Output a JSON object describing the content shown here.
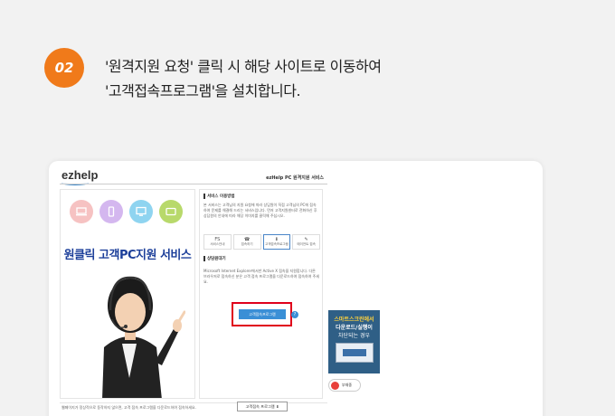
{
  "step": {
    "number": "02"
  },
  "instruction": {
    "line1": "'원격지원 요청' 클릭 시 해당 사이트로 이동하여",
    "line2": "'고객접속프로그램'을 설치합니다."
  },
  "site": {
    "logo": "ezhelp",
    "header_title": "ezHelp PC 원격지원 서비스",
    "service_title": "원클릭 고객PC지원 서비스",
    "icons": [
      "laptop-icon",
      "mobile-icon",
      "monitor-icon",
      "tablet-icon"
    ],
    "section1_heading": "서비스 이용방법",
    "section1_text": "본 서비스는 고객님의 지원 요청에 따라 상담원이 직접 고객님의 PC에 접속하여 문제를 해결해 드리는 서비스입니다. 먼저 고객지원센터로 전화하신 후 상담원의 안내에 따라 해당 이미지를 클릭해 주십시오.",
    "tiles": [
      {
        "glyph": "FS",
        "label": "서비스안내"
      },
      {
        "glyph": "☎",
        "label": "접속하기"
      },
      {
        "glyph": "⬇",
        "label": "고객접속프로그램"
      },
      {
        "glyph": "✎",
        "label": "에이전트 접속"
      }
    ],
    "section2_heading": "상담원대기",
    "section2_text": "Microsoft Internet Explorer에서만 Active X 접속을 지원합니다. 다른 브라우저로 접속하신 분은 고객 접속 프로그램을 다운로드하여 접속하여 주세요.",
    "download_button": "고객접속프로그램",
    "help_mark": "?",
    "banner": {
      "line1": "스마트스크린에서",
      "line2": "다운로드/실행이",
      "line3": "차단되는 경우"
    },
    "chat_pill": "부재중",
    "footer_text": "웹페이지가 정상적으로 동작하지 않으면, 고객 접속 프로그램을 다운로드하여 접속하세요.",
    "footer_button": "고객접속 프로그램 ⬇"
  },
  "colors": {
    "badge": "#f07a1a",
    "brand_blue": "#1c3f9a",
    "highlight_red": "#e0001b"
  }
}
